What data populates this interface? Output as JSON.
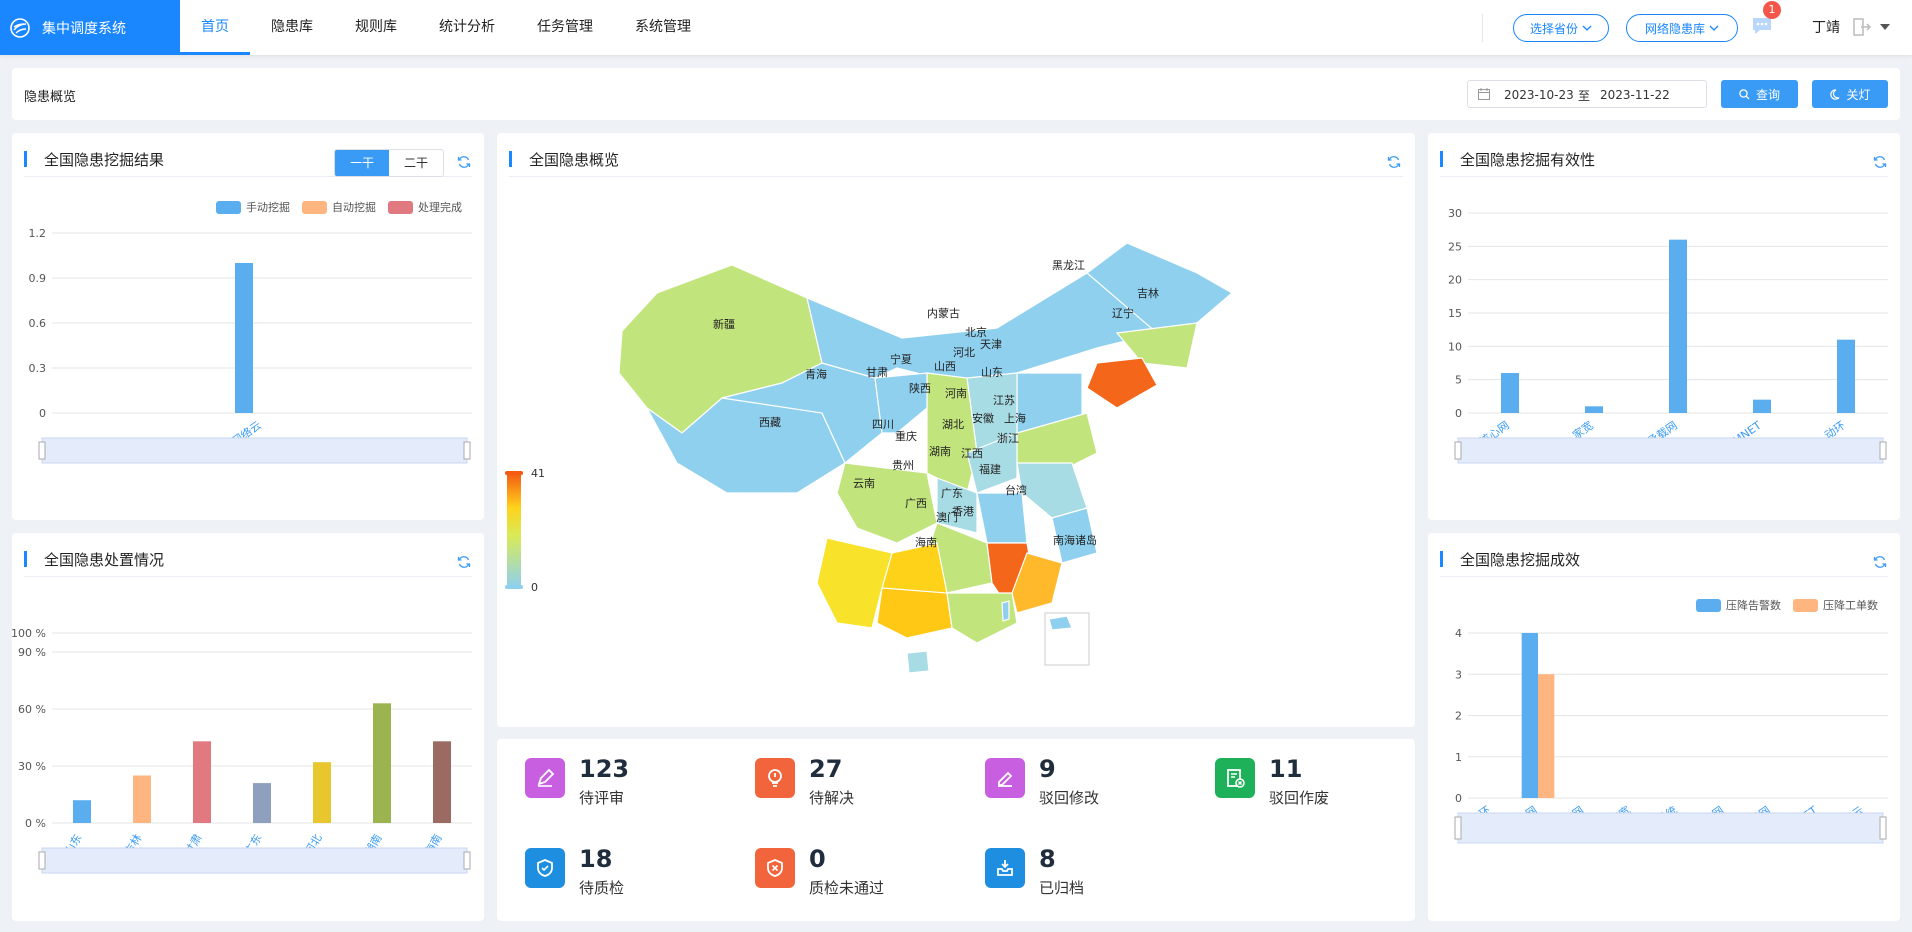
{
  "header": {
    "brand": "集中调度系统",
    "nav": [
      "首页",
      "隐患库",
      "规则库",
      "统计分析",
      "任务管理",
      "系统管理"
    ],
    "province_select": "选择省份",
    "library_select": "网络隐患库",
    "badge_count": "1",
    "user": "丁靖"
  },
  "toolbar": {
    "title": "隐患概览",
    "date_start": "2023-10-23",
    "date_sep": "至",
    "date_end": "2023-11-22",
    "query_label": "查询",
    "light_label": "关灯"
  },
  "colors": {
    "primary": "#1a86ff",
    "manual": "#5aaef0",
    "auto": "#ffb57f",
    "done": "#e07a80"
  },
  "panel_mining": {
    "title": "全国隐患挖掘结果",
    "seg": [
      "一干",
      "二干"
    ],
    "legend": [
      "手动挖掘",
      "自动挖掘",
      "处理完成"
    ]
  },
  "panel_disposal": {
    "title": "全国隐患处置情况"
  },
  "panel_map": {
    "title": "全国隐患概览",
    "scale_max": "41",
    "scale_min": "0",
    "south_sea": "南海诸岛",
    "provinces": [
      "黑龙江",
      "吉林",
      "辽宁",
      "内蒙古",
      "北京",
      "天津",
      "河北",
      "山西",
      "山东",
      "宁夏",
      "甘肃",
      "新疆",
      "青海",
      "陕西",
      "河南",
      "江苏",
      "安徽",
      "上海",
      "西藏",
      "四川",
      "重庆",
      "湖北",
      "浙江",
      "湖南",
      "江西",
      "贵州",
      "云南",
      "福建",
      "台湾",
      "广西",
      "广东",
      "香港",
      "澳门",
      "海南"
    ]
  },
  "panel_effect": {
    "title": "全国隐患挖掘有效性"
  },
  "panel_result": {
    "title": "全国隐患挖掘成效",
    "legend": [
      "压降告警数",
      "压降工单数"
    ]
  },
  "stats": [
    {
      "num": "123",
      "label": "待评审",
      "icon": "pen-icon",
      "color": "#c85fe0"
    },
    {
      "num": "27",
      "label": "待解决",
      "icon": "bulb-icon",
      "color": "#f2643c"
    },
    {
      "num": "9",
      "label": "驳回修改",
      "icon": "edit-icon",
      "color": "#c85fe0"
    },
    {
      "num": "11",
      "label": "驳回作废",
      "icon": "doc-cancel-icon",
      "color": "#1fb05a"
    },
    {
      "num": "18",
      "label": "待质检",
      "icon": "shield-check-icon",
      "color": "#1e8fe0"
    },
    {
      "num": "0",
      "label": "质检未通过",
      "icon": "shield-fail-icon",
      "color": "#f2643c"
    },
    {
      "num": "8",
      "label": "已归档",
      "icon": "archive-icon",
      "color": "#1e8fe0"
    }
  ],
  "chart_data": [
    {
      "type": "bar",
      "title": "全国隐患挖掘结果",
      "categories": [
        "网络云"
      ],
      "series": [
        {
          "name": "手动挖掘",
          "values": [
            1
          ]
        },
        {
          "name": "自动挖掘",
          "values": [
            0
          ]
        },
        {
          "name": "处理完成",
          "values": [
            0
          ]
        }
      ],
      "yticks": [
        "0",
        "0.3",
        "0.6",
        "0.9",
        "1.2"
      ],
      "ylim": [
        0,
        1.2
      ]
    },
    {
      "type": "bar",
      "title": "全国隐患处置情况",
      "categories": [
        "山东",
        "吉林",
        "甘肃",
        "广东",
        "河北",
        "湖南",
        "海南"
      ],
      "values": [
        12,
        25,
        43,
        21,
        32,
        63,
        43
      ],
      "bar_colors": [
        "#5aaef0",
        "#ffb57f",
        "#e07a80",
        "#8ea0bd",
        "#e8c62d",
        "#9bb44f",
        "#9b6b63"
      ],
      "yticks": [
        "0 %",
        "30 %",
        "60 %",
        "90 %",
        "100 %"
      ],
      "ylim": [
        0,
        100
      ]
    },
    {
      "type": "bar",
      "title": "全国隐患挖掘有效性",
      "categories": [
        "核心网",
        "家宽",
        "IP承载网",
        "CMNET",
        "动环"
      ],
      "values": [
        6,
        1,
        26,
        2,
        11
      ],
      "yticks": [
        "0",
        "5",
        "10",
        "15",
        "20",
        "25",
        "30"
      ],
      "ylim": [
        0,
        30
      ]
    },
    {
      "type": "bar",
      "title": "全国隐患挖掘成效",
      "categories": [
        "动环",
        "核心网",
        "内容网",
        "家宽",
        "网管系统",
        "传输网",
        "IP承载网",
        "CMNET",
        "网络云"
      ],
      "series": [
        {
          "name": "压降告警数",
          "values": [
            0,
            4,
            0,
            0,
            0,
            0,
            0,
            0,
            0
          ]
        },
        {
          "name": "压降工单数",
          "values": [
            0,
            3,
            0,
            0,
            0,
            0,
            0,
            0,
            0
          ]
        }
      ],
      "yticks": [
        "0",
        "1",
        "2",
        "3",
        "4"
      ],
      "ylim": [
        0,
        4
      ]
    }
  ]
}
